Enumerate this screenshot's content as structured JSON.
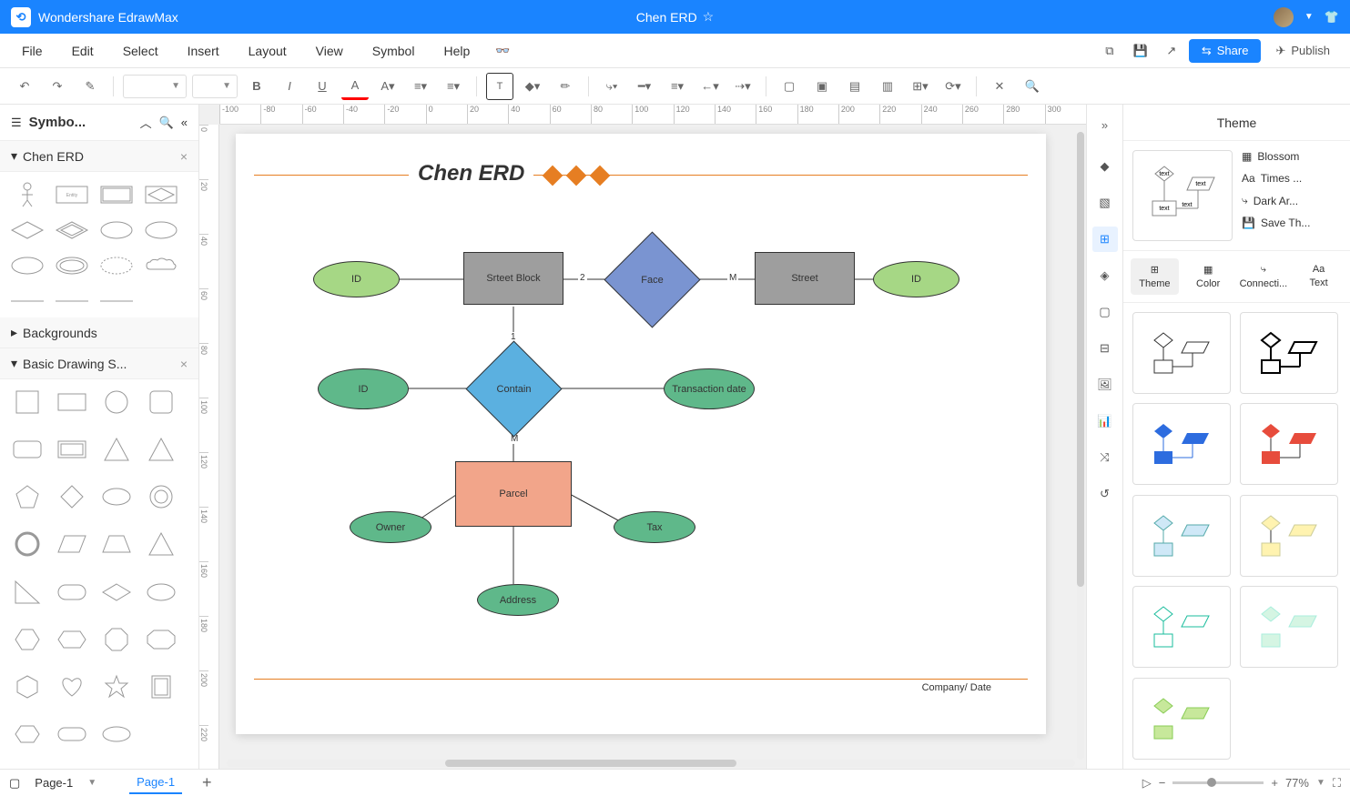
{
  "app": {
    "name": "Wondershare EdrawMax",
    "document": "Chen ERD"
  },
  "menubar": {
    "items": [
      "File",
      "Edit",
      "Select",
      "Insert",
      "Layout",
      "View",
      "Symbol",
      "Help"
    ],
    "share": "Share",
    "publish": "Publish"
  },
  "leftpanel": {
    "title": "Symbo...",
    "sections": {
      "chen": "Chen ERD",
      "backgrounds": "Backgrounds",
      "basic": "Basic Drawing S..."
    }
  },
  "rightpanel": {
    "title": "Theme",
    "props": {
      "font_label": "Blossom",
      "family": "Times ...",
      "connector": "Dark Ar...",
      "save": "Save Th..."
    },
    "tabs": {
      "theme": "Theme",
      "color": "Color",
      "connector": "Connecti...",
      "text": "Text"
    }
  },
  "canvas": {
    "title": "Chen ERD",
    "footer": "Company/ Date",
    "nodes": {
      "srteet_block": "Srteet Block",
      "street": "Street",
      "face": "Face",
      "contain": "Contain",
      "parcel": "Parcel",
      "id1": "ID",
      "id2": "ID",
      "id3": "ID",
      "transaction": "Transaction date",
      "owner": "Owner",
      "tax": "Tax",
      "address": "Address"
    },
    "labels": {
      "two": "2",
      "m1": "M",
      "one": "1",
      "m2": "M"
    }
  },
  "statusbar": {
    "page": "Page-1",
    "tab": "Page-1",
    "zoom": "77%"
  },
  "ruler_h": [
    "-100",
    "-80",
    "-60",
    "-40",
    "-20",
    "0",
    "20",
    "40",
    "60",
    "80",
    "100",
    "120",
    "140",
    "160",
    "180",
    "200",
    "220",
    "240",
    "260",
    "280",
    "300"
  ],
  "ruler_v": [
    "0",
    "20",
    "40",
    "60",
    "80",
    "100",
    "120",
    "140",
    "160",
    "180",
    "200",
    "220"
  ],
  "chart_data": {
    "type": "erd",
    "title": "Chen ERD",
    "entities": [
      {
        "name": "Srteet Block",
        "attributes": [
          "ID"
        ]
      },
      {
        "name": "Street",
        "attributes": [
          "ID"
        ]
      },
      {
        "name": "Parcel",
        "attributes": [
          "ID",
          "Transaction date",
          "Owner",
          "Tax",
          "Address"
        ]
      }
    ],
    "relationships": [
      {
        "name": "Face",
        "between": [
          "Srteet Block",
          "Street"
        ],
        "cardinality": [
          "2",
          "M"
        ]
      },
      {
        "name": "Contain",
        "between": [
          "Srteet Block",
          "Parcel"
        ],
        "cardinality": [
          "1",
          "M"
        ]
      }
    ]
  }
}
